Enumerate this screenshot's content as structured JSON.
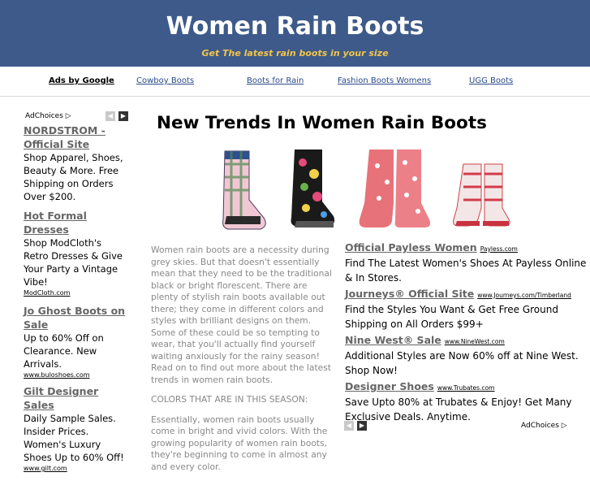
{
  "header": {
    "title": "Women Rain Boots",
    "tagline": "Get The latest rain boots in your size",
    "bg_color": "#3d5a8a",
    "tagline_color": "#f2c44a"
  },
  "topnav": {
    "ads_label": "Ads by Google",
    "links": [
      "Cowboy Boots",
      "Boots for Rain",
      "Fashion Boots Womens",
      "UGG Boots"
    ]
  },
  "left_ads": {
    "adchoices": "AdChoices",
    "items": [
      {
        "title": "NORDSTROM - Official Site",
        "desc": "Shop Apparel, Shoes, Beauty & More. Free Shipping on Orders Over $200.",
        "url": ""
      },
      {
        "title": "Hot Formal Dresses",
        "desc": "Shop ModCloth's Retro Dresses & Give Your Party a Vintage Vibe!",
        "url": "ModCloth.com"
      },
      {
        "title": "Jo Ghost Boots on Sale",
        "desc": "Up to 60% Off on Clearance. New Arrivals.",
        "url": "www.buloshoes.com"
      },
      {
        "title": "Gilt Designer Sales",
        "desc": "Daily Sample Sales. Insider Prices. Women's Luxury Shoes Up to 60% Off!",
        "url": "www.gilt.com"
      }
    ]
  },
  "main": {
    "title": "New Trends In Women Rain Boots",
    "paragraphs": [
      "Women rain boots are a necessity during grey skies. But that doesn't essentially mean that they need to be the traditional black or bright florescent. There are plenty of stylish rain boots available out there; they come in different colors and styles with brilliant designs on them. Some of these could be so tempting to wear, that you'll actually find yourself waiting anxiously for the rainy season! Read on to find out more about the latest trends in women rain boots.",
      "COLORS THAT ARE IN THIS SEASON:",
      "Essentially, women rain boots usually come in bright and vivid colors. With the growing popularity of women rain boots, they're beginning to come in almost any and every color."
    ]
  },
  "right_ads": {
    "adchoices": "AdChoices",
    "items": [
      {
        "title": "Official Payless Women",
        "url": "Payless.com",
        "desc": "Find The Latest Women's Shoes At Payless Online & In Stores."
      },
      {
        "title": "Journeys® Official Site",
        "url": "www.Journeys.com/Timberland",
        "desc": "Find the Styles You Want & Get Free Ground Shipping on All Orders $99+"
      },
      {
        "title": "Nine West® Sale",
        "url": "www.NineWest.com",
        "desc": "Additional Styles are Now 60% off at Nine West. Shop Now!"
      },
      {
        "title": "Designer Shoes",
        "url": "www.Trubates.com",
        "desc": "Save Upto 80% at Trubates & Enjoy! Get Many Exclusive Deals. Anytime."
      }
    ]
  }
}
